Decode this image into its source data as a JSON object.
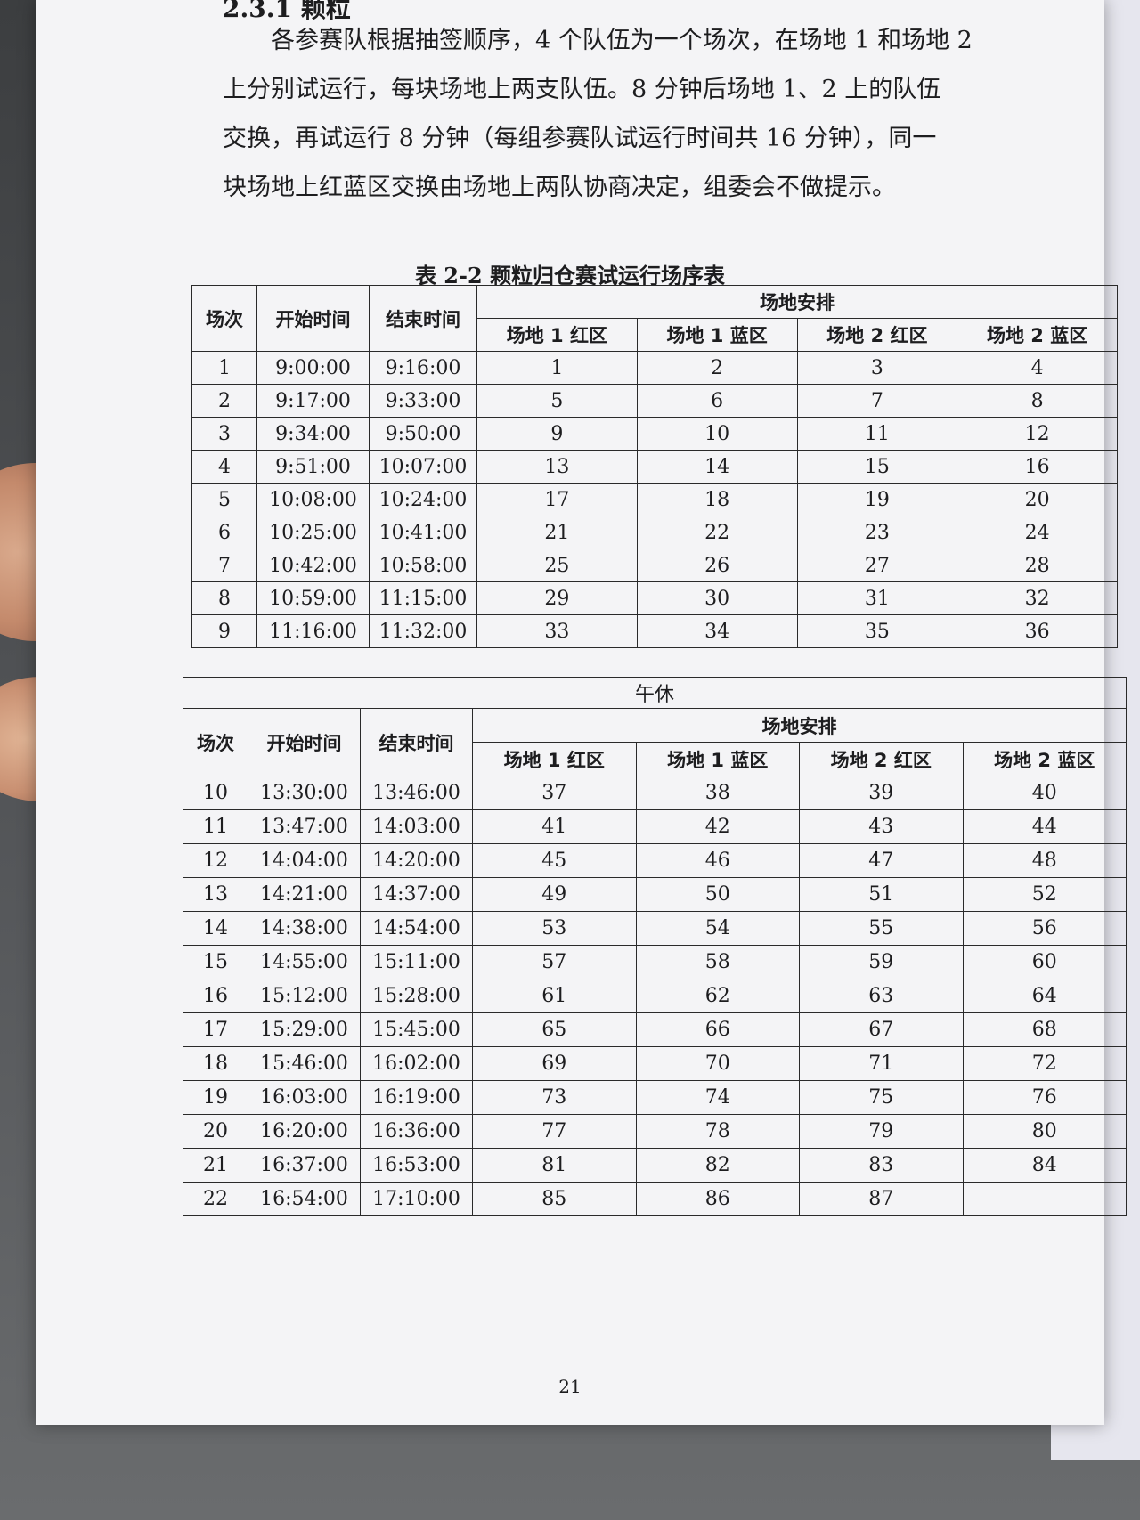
{
  "section_heading": "2.3.1 颗粒",
  "paragraph_lines": [
    "各参赛队根据抽签顺序，4 个队伍为一个场次，在场地 1 和场地 2",
    "上分别试运行，每块场地上两支队伍。8 分钟后场地 1、2 上的队伍",
    "交换，再试运行 8 分钟（每组参赛队试运行时间共 16 分钟），同一",
    "块场地上红蓝区交换由场地上两队协商决定，组委会不做提示。"
  ],
  "table_caption": "表 2-2 颗粒归仓赛试运行场序表",
  "table_headers": {
    "round": "场次",
    "start": "开始时间",
    "end": "结束时间",
    "arrangement": "场地安排",
    "zones": [
      "场地 1 红区",
      "场地 1 蓝区",
      "场地 2 红区",
      "场地 2 蓝区"
    ]
  },
  "morning_rows": [
    [
      "1",
      "9:00:00",
      "9:16:00",
      "1",
      "2",
      "3",
      "4"
    ],
    [
      "2",
      "9:17:00",
      "9:33:00",
      "5",
      "6",
      "7",
      "8"
    ],
    [
      "3",
      "9:34:00",
      "9:50:00",
      "9",
      "10",
      "11",
      "12"
    ],
    [
      "4",
      "9:51:00",
      "10:07:00",
      "13",
      "14",
      "15",
      "16"
    ],
    [
      "5",
      "10:08:00",
      "10:24:00",
      "17",
      "18",
      "19",
      "20"
    ],
    [
      "6",
      "10:25:00",
      "10:41:00",
      "21",
      "22",
      "23",
      "24"
    ],
    [
      "7",
      "10:42:00",
      "10:58:00",
      "25",
      "26",
      "27",
      "28"
    ],
    [
      "8",
      "10:59:00",
      "11:15:00",
      "29",
      "30",
      "31",
      "32"
    ],
    [
      "9",
      "11:16:00",
      "11:32:00",
      "33",
      "34",
      "35",
      "36"
    ]
  ],
  "lunch_label": "午休",
  "afternoon_rows": [
    [
      "10",
      "13:30:00",
      "13:46:00",
      "37",
      "38",
      "39",
      "40"
    ],
    [
      "11",
      "13:47:00",
      "14:03:00",
      "41",
      "42",
      "43",
      "44"
    ],
    [
      "12",
      "14:04:00",
      "14:20:00",
      "45",
      "46",
      "47",
      "48"
    ],
    [
      "13",
      "14:21:00",
      "14:37:00",
      "49",
      "50",
      "51",
      "52"
    ],
    [
      "14",
      "14:38:00",
      "14:54:00",
      "53",
      "54",
      "55",
      "56"
    ],
    [
      "15",
      "14:55:00",
      "15:11:00",
      "57",
      "58",
      "59",
      "60"
    ],
    [
      "16",
      "15:12:00",
      "15:28:00",
      "61",
      "62",
      "63",
      "64"
    ],
    [
      "17",
      "15:29:00",
      "15:45:00",
      "65",
      "66",
      "67",
      "68"
    ],
    [
      "18",
      "15:46:00",
      "16:02:00",
      "69",
      "70",
      "71",
      "72"
    ],
    [
      "19",
      "16:03:00",
      "16:19:00",
      "73",
      "74",
      "75",
      "76"
    ],
    [
      "20",
      "16:20:00",
      "16:36:00",
      "77",
      "78",
      "79",
      "80"
    ],
    [
      "21",
      "16:37:00",
      "16:53:00",
      "81",
      "82",
      "83",
      "84"
    ],
    [
      "22",
      "16:54:00",
      "17:10:00",
      "85",
      "86",
      "87",
      ""
    ]
  ],
  "page_number": "21"
}
